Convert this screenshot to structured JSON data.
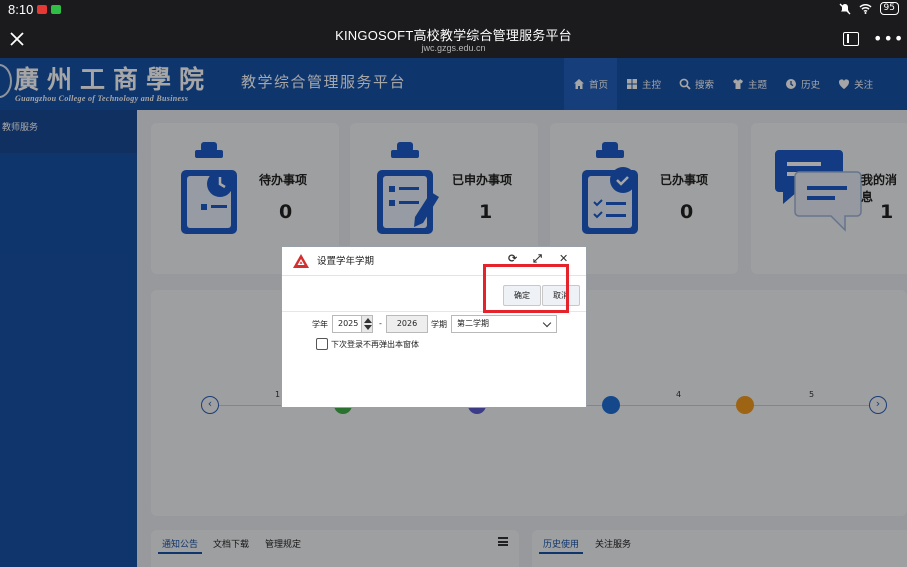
{
  "status": {
    "time": "8:10",
    "battery": "95"
  },
  "browser": {
    "title": "KINGOSOFT高校教学综合管理服务平台",
    "url": "jwc.gzgs.edu.cn"
  },
  "header": {
    "logo_cn": "廣州工商學院",
    "logo_en": "Guangzhou College of Technology and Business",
    "site_name": "教学综合管理服务平台",
    "nav": [
      {
        "label": "首页",
        "icon": "home-icon"
      },
      {
        "label": "主控",
        "icon": "grid-icon"
      },
      {
        "label": "搜索",
        "icon": "search-icon"
      },
      {
        "label": "主题",
        "icon": "shirt-icon"
      },
      {
        "label": "历史",
        "icon": "clock-icon"
      },
      {
        "label": "关注",
        "icon": "heart-icon"
      }
    ]
  },
  "sidebar": {
    "items": [
      {
        "label": "教师服务"
      }
    ]
  },
  "cards": [
    {
      "title": "待办事项",
      "count": "0"
    },
    {
      "title": "已申办事项",
      "count": "1"
    },
    {
      "title": "已办事项",
      "count": "0"
    },
    {
      "title": "我的消息",
      "count": "1"
    }
  ],
  "timeline": {
    "labels": [
      "1",
      "4",
      "5"
    ]
  },
  "bottom_tabs": {
    "left": [
      "通知公告",
      "文档下载",
      "管理规定"
    ],
    "right": [
      "历史使用",
      "关注服务"
    ]
  },
  "dialog": {
    "title": "设置学年学期",
    "ok_label": "确定",
    "cancel_label": "取消",
    "year_label": "学年",
    "year_start": "2025",
    "dash": "-",
    "year_end": "2026",
    "term_label": "学期",
    "term_value": "第二学期",
    "checkbox_label": "下次登录不再弹出本窗体"
  },
  "colors": {
    "brand": "#1852a8",
    "highlight": "#e5232a"
  }
}
